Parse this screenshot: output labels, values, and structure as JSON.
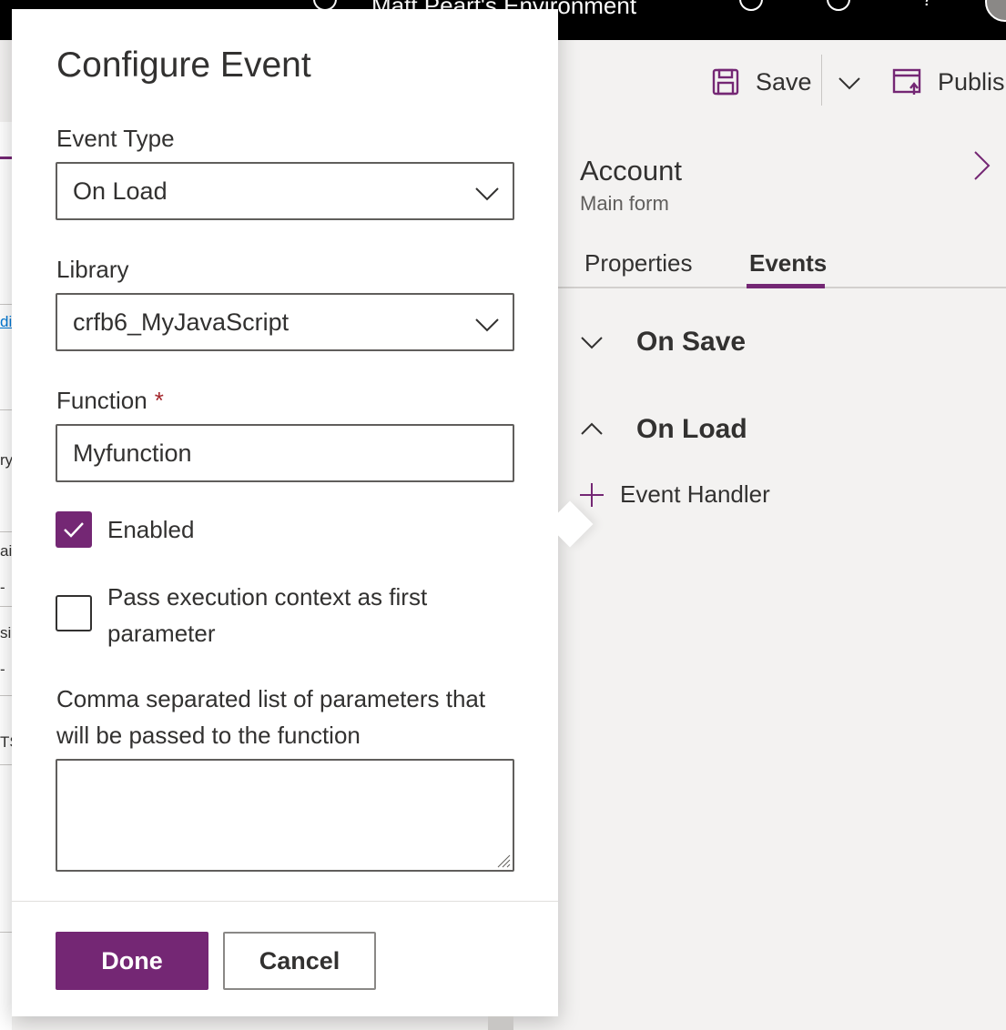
{
  "topbar": {
    "environment": "Matt Peart's Environment"
  },
  "commandbar": {
    "save_label": "Save",
    "publish_label": "Publish"
  },
  "left_strip": {
    "fragments": [
      "di",
      "ry",
      "ai",
      "-",
      "si",
      "-",
      "TS"
    ]
  },
  "right_panel": {
    "title": "Account",
    "subtitle": "Main form",
    "tabs": [
      {
        "label": "Properties",
        "active": false
      },
      {
        "label": "Events",
        "active": true
      }
    ],
    "sections": [
      {
        "label": "On Save",
        "expanded": false
      },
      {
        "label": "On Load",
        "expanded": true
      }
    ],
    "add_handler_label": "Event Handler"
  },
  "dialog": {
    "title": "Configure Event",
    "event_type": {
      "label": "Event Type",
      "value": "On Load"
    },
    "library": {
      "label": "Library",
      "value": "crfb6_MyJavaScript"
    },
    "function": {
      "label": "Function",
      "required_marker": "*",
      "value": "Myfunction"
    },
    "enabled": {
      "label": "Enabled",
      "checked": true
    },
    "pass_context": {
      "label": "Pass execution context as first parameter",
      "checked": false
    },
    "parameters": {
      "label": "Comma separated list of parameters that will be passed to the function",
      "value": ""
    },
    "done_label": "Done",
    "cancel_label": "Cancel"
  },
  "colors": {
    "accent": "#742774",
    "required": "#a4262c",
    "panel_bg": "#f3f2f1",
    "topbar_bg": "#000000"
  },
  "icons": [
    "bell-icon",
    "gear-icon",
    "help-icon",
    "save-icon",
    "chevron-down-icon",
    "publish-icon",
    "chevron-right-icon",
    "chevron-up-icon",
    "plus-icon",
    "checkmark-icon"
  ]
}
